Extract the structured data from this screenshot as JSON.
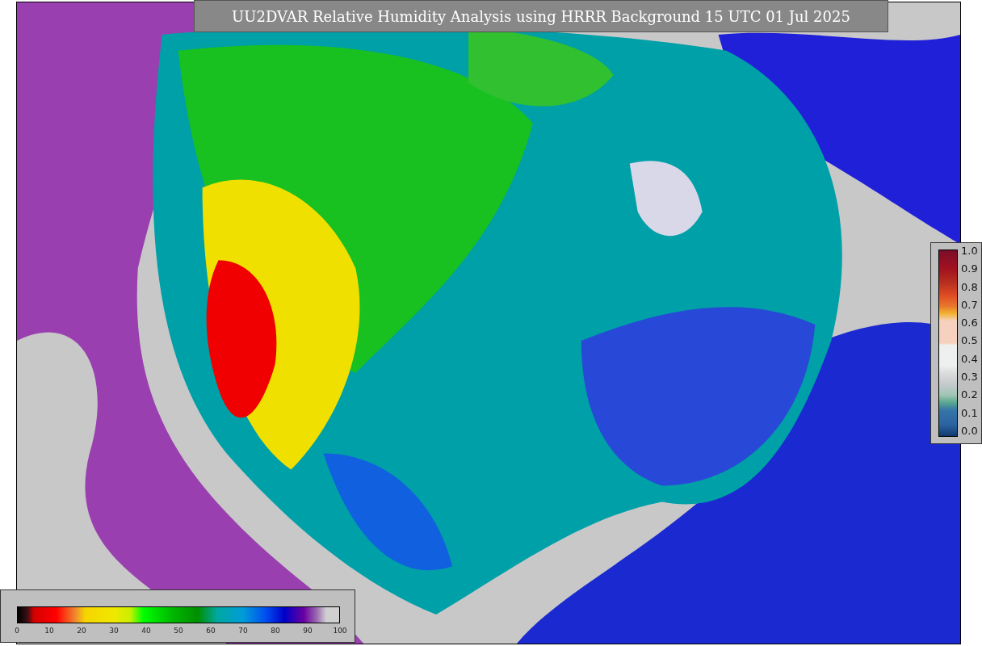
{
  "title": "UU2DVAR Relative Humidity Analysis using HRRR Background 15 UTC 01 Jul 2025",
  "fraction_colorbar": {
    "ticks": [
      "1.0",
      "0.9",
      "0.8",
      "0.7",
      "0.6",
      "0.5",
      "0.4",
      "0.3",
      "0.2",
      "0.1",
      "0.0"
    ]
  },
  "percent_colorbar": {
    "ticks": [
      "0",
      "10",
      "20",
      "30",
      "40",
      "50",
      "60",
      "70",
      "80",
      "90",
      "100"
    ]
  }
}
